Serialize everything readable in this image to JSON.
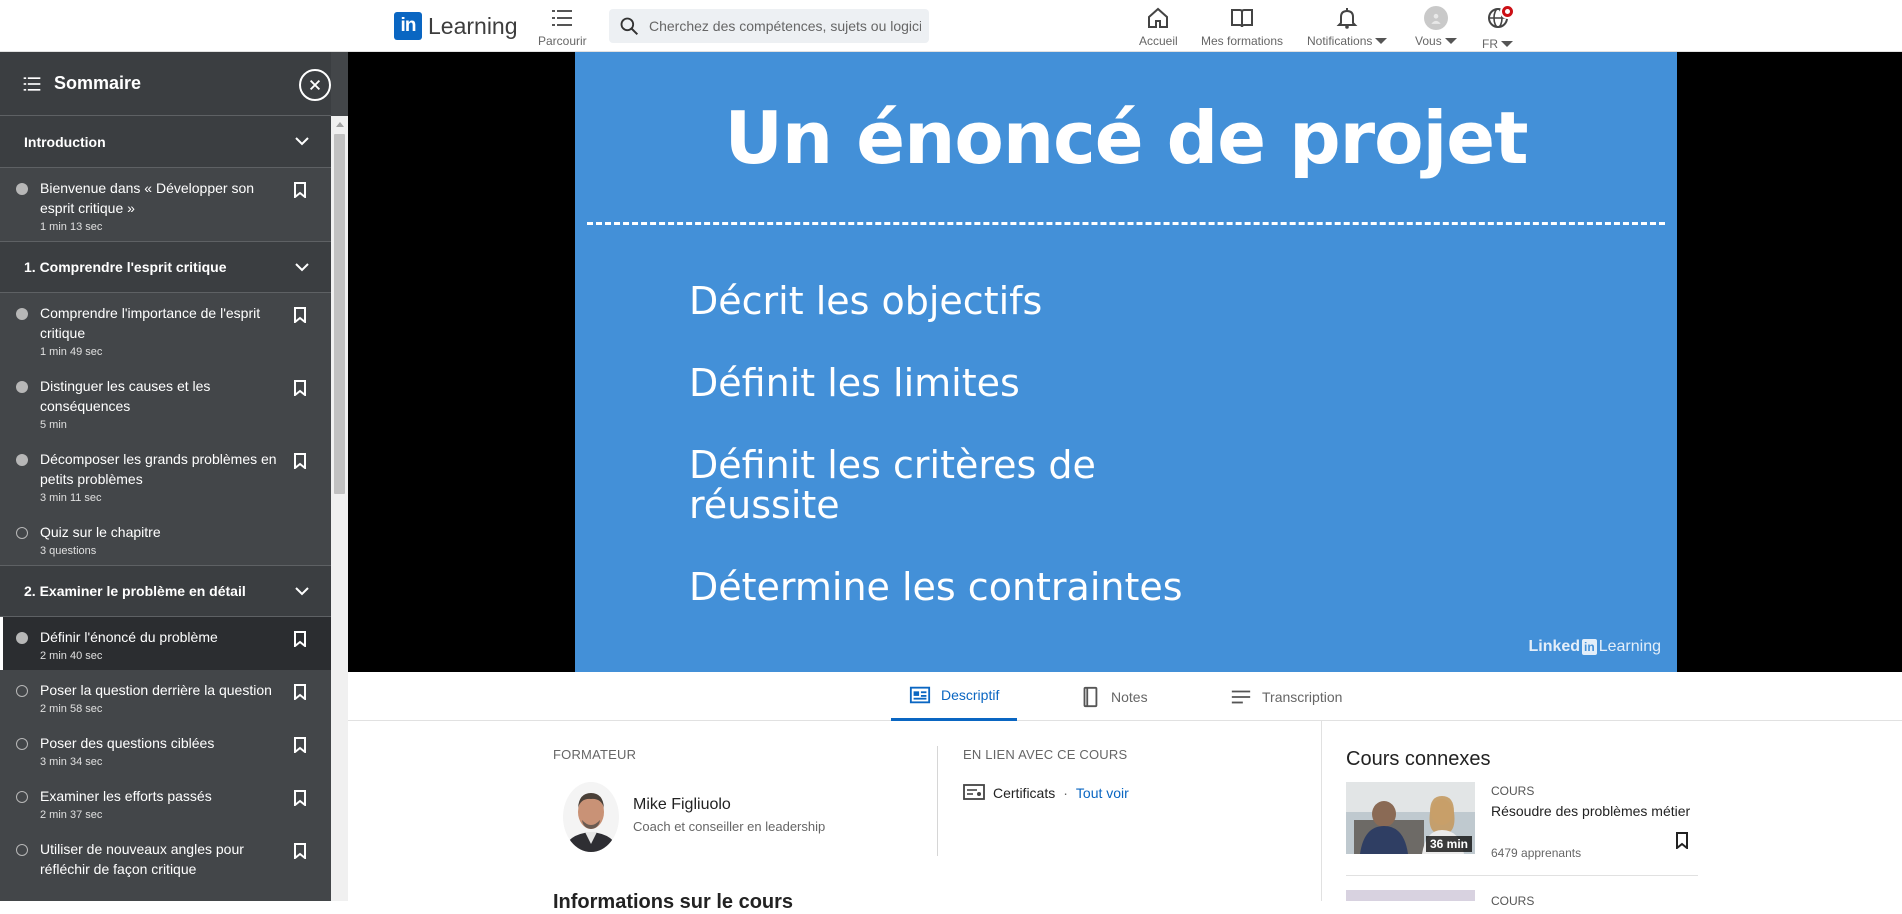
{
  "brand": {
    "logo_mark": "in",
    "name": "Learning"
  },
  "nav": {
    "browse_label": "Parcourir",
    "search_placeholder": "Cherchez des compétences, sujets ou logiciels",
    "home_label": "Accueil",
    "my_courses_label": "Mes formations",
    "notifications_label": "Notifications",
    "me_label": "Vous",
    "language_label": "FR",
    "icons": [
      "list-icon",
      "search-icon",
      "home-icon",
      "book-icon",
      "bell-icon",
      "avatar",
      "globe-icon"
    ]
  },
  "sidebar": {
    "title": "Sommaire",
    "chapters": [
      {
        "title": "Introduction",
        "items": [
          {
            "name": "Bienvenue dans « Développer son esprit critique »",
            "duration": "1 min 13 sec",
            "status": "viewed"
          }
        ]
      },
      {
        "title": "1. Comprendre l'esprit critique",
        "items": [
          {
            "name": "Comprendre l'importance de l'esprit critique",
            "duration": "1 min 49 sec",
            "status": "viewed"
          },
          {
            "name": "Distinguer les causes et les conséquences",
            "duration": "5 min",
            "status": "viewed"
          },
          {
            "name": "Décomposer les grands problèmes en petits problèmes",
            "duration": "3 min 11 sec",
            "status": "viewed"
          },
          {
            "name": "Quiz sur le chapitre",
            "duration": "3 questions",
            "status": "not-started"
          }
        ]
      },
      {
        "title": "2. Examiner le problème en détail",
        "items": [
          {
            "name": "Définir l'énoncé du problème",
            "duration": "2 min 40 sec",
            "status": "active"
          },
          {
            "name": "Poser la question derrière la question",
            "duration": "2 min 58 sec",
            "status": "not-started"
          },
          {
            "name": "Poser des questions ciblées",
            "duration": "3 min 34 sec",
            "status": "not-started"
          },
          {
            "name": "Examiner les efforts passés",
            "duration": "2 min 37 sec",
            "status": "not-started"
          },
          {
            "name": "Utiliser de nouveaux angles pour réfléchir de façon critique",
            "duration": "",
            "status": "not-started"
          }
        ]
      }
    ]
  },
  "slide": {
    "title": "Un énoncé de projet",
    "bullets": [
      "Décrit les objectifs",
      "Définit les limites",
      "Définit les critères de réussite",
      "Détermine les contraintes"
    ],
    "brand_left": "Linked",
    "brand_mark": "in",
    "brand_right": "Learning",
    "background_color": "#4390d8"
  },
  "tabs": [
    {
      "label": "Descriptif",
      "active": true
    },
    {
      "label": "Notes",
      "active": false
    },
    {
      "label": "Transcription",
      "active": false
    }
  ],
  "details": {
    "instructor_label": "FORMATEUR",
    "instructor_name": "Mike Figliuolo",
    "instructor_role": "Coach et conseiller en leadership",
    "related_label": "EN LIEN AVEC CE COURS",
    "certificates_label": "Certificats",
    "see_all_label": "Tout voir",
    "info_heading": "Informations sur le cours"
  },
  "related_courses": {
    "title": "Cours connexes",
    "items": [
      {
        "type": "COURS",
        "name": "Résoudre des problèmes métier",
        "duration": "36 min",
        "learners": "6479 apprenants"
      },
      {
        "type": "COURS"
      }
    ]
  },
  "colors": {
    "accent": "#0a66c2",
    "sidebar_bg": "#434649",
    "notification_badge": "#cc1016"
  }
}
